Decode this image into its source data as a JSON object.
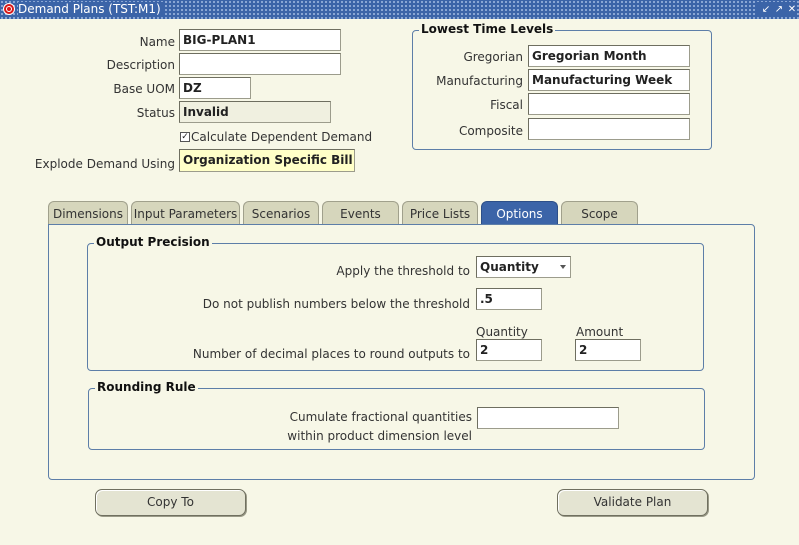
{
  "window": {
    "title": "Demand Plans (TST:M1)"
  },
  "header": {
    "name_label": "Name",
    "name_value": "BIG-PLAN1",
    "description_label": "Description",
    "description_value": "",
    "uom_label": "Base UOM",
    "uom_value": "DZ",
    "status_label": "Status",
    "status_value": "Invalid",
    "calc_dependent_label": "Calculate Dependent Demand",
    "calc_dependent_checked": true,
    "explode_label": "Explode Demand Using",
    "explode_value": "Organization Specific Bill of"
  },
  "time_levels": {
    "title": "Lowest Time Levels",
    "gregorian_label": "Gregorian",
    "gregorian_value": "Gregorian Month",
    "manufacturing_label": "Manufacturing",
    "manufacturing_value": "Manufacturing Week",
    "fiscal_label": "Fiscal",
    "fiscal_value": "",
    "composite_label": "Composite",
    "composite_value": ""
  },
  "tabs": [
    {
      "label": "Dimensions"
    },
    {
      "label": "Input Parameters"
    },
    {
      "label": "Scenarios"
    },
    {
      "label": "Events"
    },
    {
      "label": "Price Lists"
    },
    {
      "label": "Options",
      "active": true
    },
    {
      "label": "Scope"
    }
  ],
  "options": {
    "output_precision": {
      "title": "Output Precision",
      "threshold_label": "Apply the threshold to",
      "threshold_value": "Quantity",
      "publish_label": "Do not publish numbers below the threshold",
      "publish_value": ".5",
      "quantity_header": "Quantity",
      "amount_header": "Amount",
      "decimals_label": "Number of decimal places to round outputs to",
      "decimals_quantity": "2",
      "decimals_amount": "2"
    },
    "rounding_rule": {
      "title": "Rounding Rule",
      "cumulate_label_line1": "Cumulate fractional quantities",
      "cumulate_label_line2": "within product dimension level",
      "cumulate_value": ""
    }
  },
  "buttons": {
    "copy_to": "Copy To",
    "validate_plan": "Validate Plan"
  },
  "colors": {
    "accent": "#3b64a8",
    "background": "#f7f7e7",
    "required": "#ffffc8"
  }
}
